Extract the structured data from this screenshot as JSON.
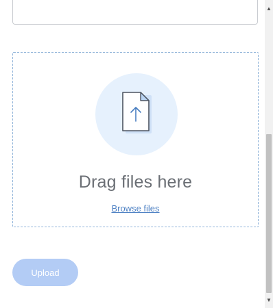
{
  "dropzone": {
    "drag_text": "Drag files here",
    "browse_label": "Browse files",
    "icon": "file-upload-icon"
  },
  "upload": {
    "label": "Upload",
    "enabled": false
  },
  "colors": {
    "accent": "#4f82c4",
    "button_disabled": "#b3ccf5",
    "dropzone_border": "#8fb3d9",
    "icon_circle": "#e6f1fd"
  },
  "scrollbar": {
    "up_icon": "chevron-up-icon",
    "down_icon": "chevron-down-icon"
  }
}
